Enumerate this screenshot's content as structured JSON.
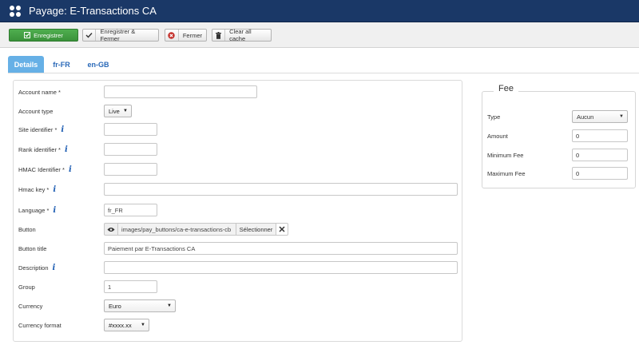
{
  "header": {
    "title": "Payage: E-Transactions CA",
    "logo_icon": "joomla-logo-icon"
  },
  "toolbar": {
    "save_label": "Enregistrer",
    "save_close_label": "Enregistrer & Fermer",
    "close_label": "Fermer",
    "clear_cache_label": "Clear all cache"
  },
  "tabs": [
    {
      "label": "Details",
      "active": true
    },
    {
      "label": "fr-FR",
      "active": false
    },
    {
      "label": "en-GB",
      "active": false
    }
  ],
  "form": {
    "account_name": {
      "label": "Account name *",
      "value": ""
    },
    "account_type": {
      "label": "Account type",
      "value": "Live"
    },
    "site_identifier": {
      "label": "Site identifier *",
      "value": ""
    },
    "rank_identifier": {
      "label": "Rank identifier *",
      "value": ""
    },
    "hmac_identifier": {
      "label": "HMAC Identifier *",
      "value": ""
    },
    "hmac_key": {
      "label": "Hmac key *",
      "value": ""
    },
    "language": {
      "label": "Language *",
      "value": "fr_FR"
    },
    "button": {
      "label": "Button",
      "path": "images/pay_buttons/ca-e-transactions-cb",
      "select_label": "Sélectionner",
      "clear_symbol": "✕"
    },
    "button_title": {
      "label": "Button title",
      "value": "Paiement par E-Transactions CA"
    },
    "description": {
      "label": "Description",
      "value": ""
    },
    "group": {
      "label": "Group",
      "value": "1"
    },
    "currency": {
      "label": "Currency",
      "value": "Euro"
    },
    "currency_format": {
      "label": "Currency format",
      "value": "#xxxx.xx"
    }
  },
  "fee": {
    "legend": "Fee",
    "type": {
      "label": "Type",
      "value": "Aucun"
    },
    "amount": {
      "label": "Amount",
      "value": "0"
    },
    "minimum": {
      "label": "Minimum Fee",
      "value": "0"
    },
    "maximum": {
      "label": "Maximum Fee",
      "value": "0"
    }
  },
  "info_glyph": "i",
  "colors": {
    "header_bg": "#1a3867",
    "save_green": "#3a923a",
    "tab_active": "#66b0e6",
    "link_blue": "#2a69b8"
  }
}
